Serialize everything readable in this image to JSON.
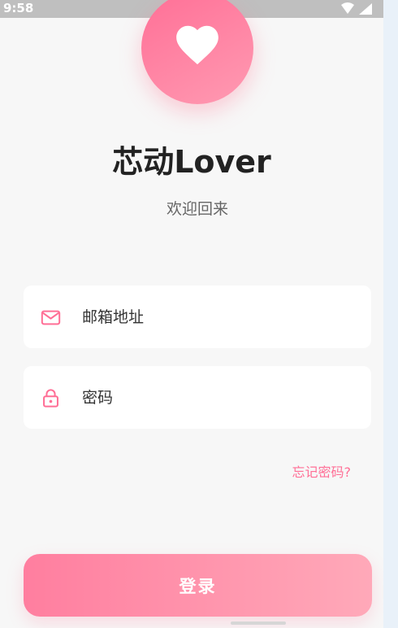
{
  "status_bar": {
    "time": "9:58",
    "icons": [
      "wifi-icon",
      "signal-icon"
    ]
  },
  "header": {
    "logo_icon": "heart-icon",
    "app_title": "芯动Lover",
    "subtitle": "欢迎回来"
  },
  "form": {
    "email": {
      "icon": "mail-icon",
      "placeholder": "邮箱地址",
      "value": ""
    },
    "password": {
      "icon": "lock-icon",
      "placeholder": "密码",
      "value": ""
    },
    "forgot_label": "忘记密码?",
    "login_label": "登录"
  },
  "colors": {
    "accent": "#ff6f96",
    "accent_light": "#ffa9b9",
    "background": "#f7f7f7",
    "field_background": "#ffffff",
    "title_text": "#222222"
  }
}
